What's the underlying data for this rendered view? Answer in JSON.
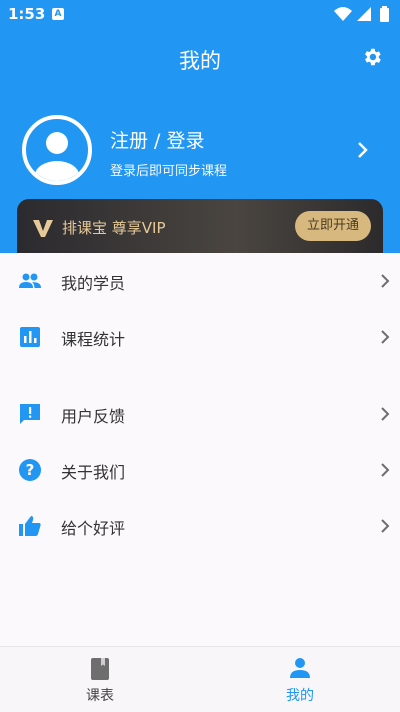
{
  "status_bar": {
    "time": "1:53",
    "app_badge": "A",
    "icons": [
      "wifi-icon",
      "signal-icon",
      "battery-icon"
    ]
  },
  "header": {
    "title": "我的",
    "settings_icon": "gear-icon"
  },
  "profile": {
    "login_label": "注册 / 登录",
    "login_hint": "登录后即可同步课程"
  },
  "vip": {
    "text": "排课宝 尊享VIP",
    "button": "立即开通",
    "logo_letter": "V"
  },
  "menu": [
    {
      "label": "我的学员",
      "icon": "people-icon"
    },
    {
      "label": "课程统计",
      "icon": "bar-chart-icon"
    },
    {
      "label": "用户反馈",
      "icon": "feedback-icon"
    },
    {
      "label": "关于我们",
      "icon": "help-icon"
    },
    {
      "label": "给个好评",
      "icon": "thumb-up-icon"
    }
  ],
  "tabs": [
    {
      "label": "课表",
      "icon": "book-icon",
      "active": false
    },
    {
      "label": "我的",
      "icon": "person-icon",
      "active": true
    }
  ],
  "colors": {
    "primary": "#2196f3",
    "vip_gold": "#d7b97f",
    "icon_gray": "#6e6e6e"
  }
}
